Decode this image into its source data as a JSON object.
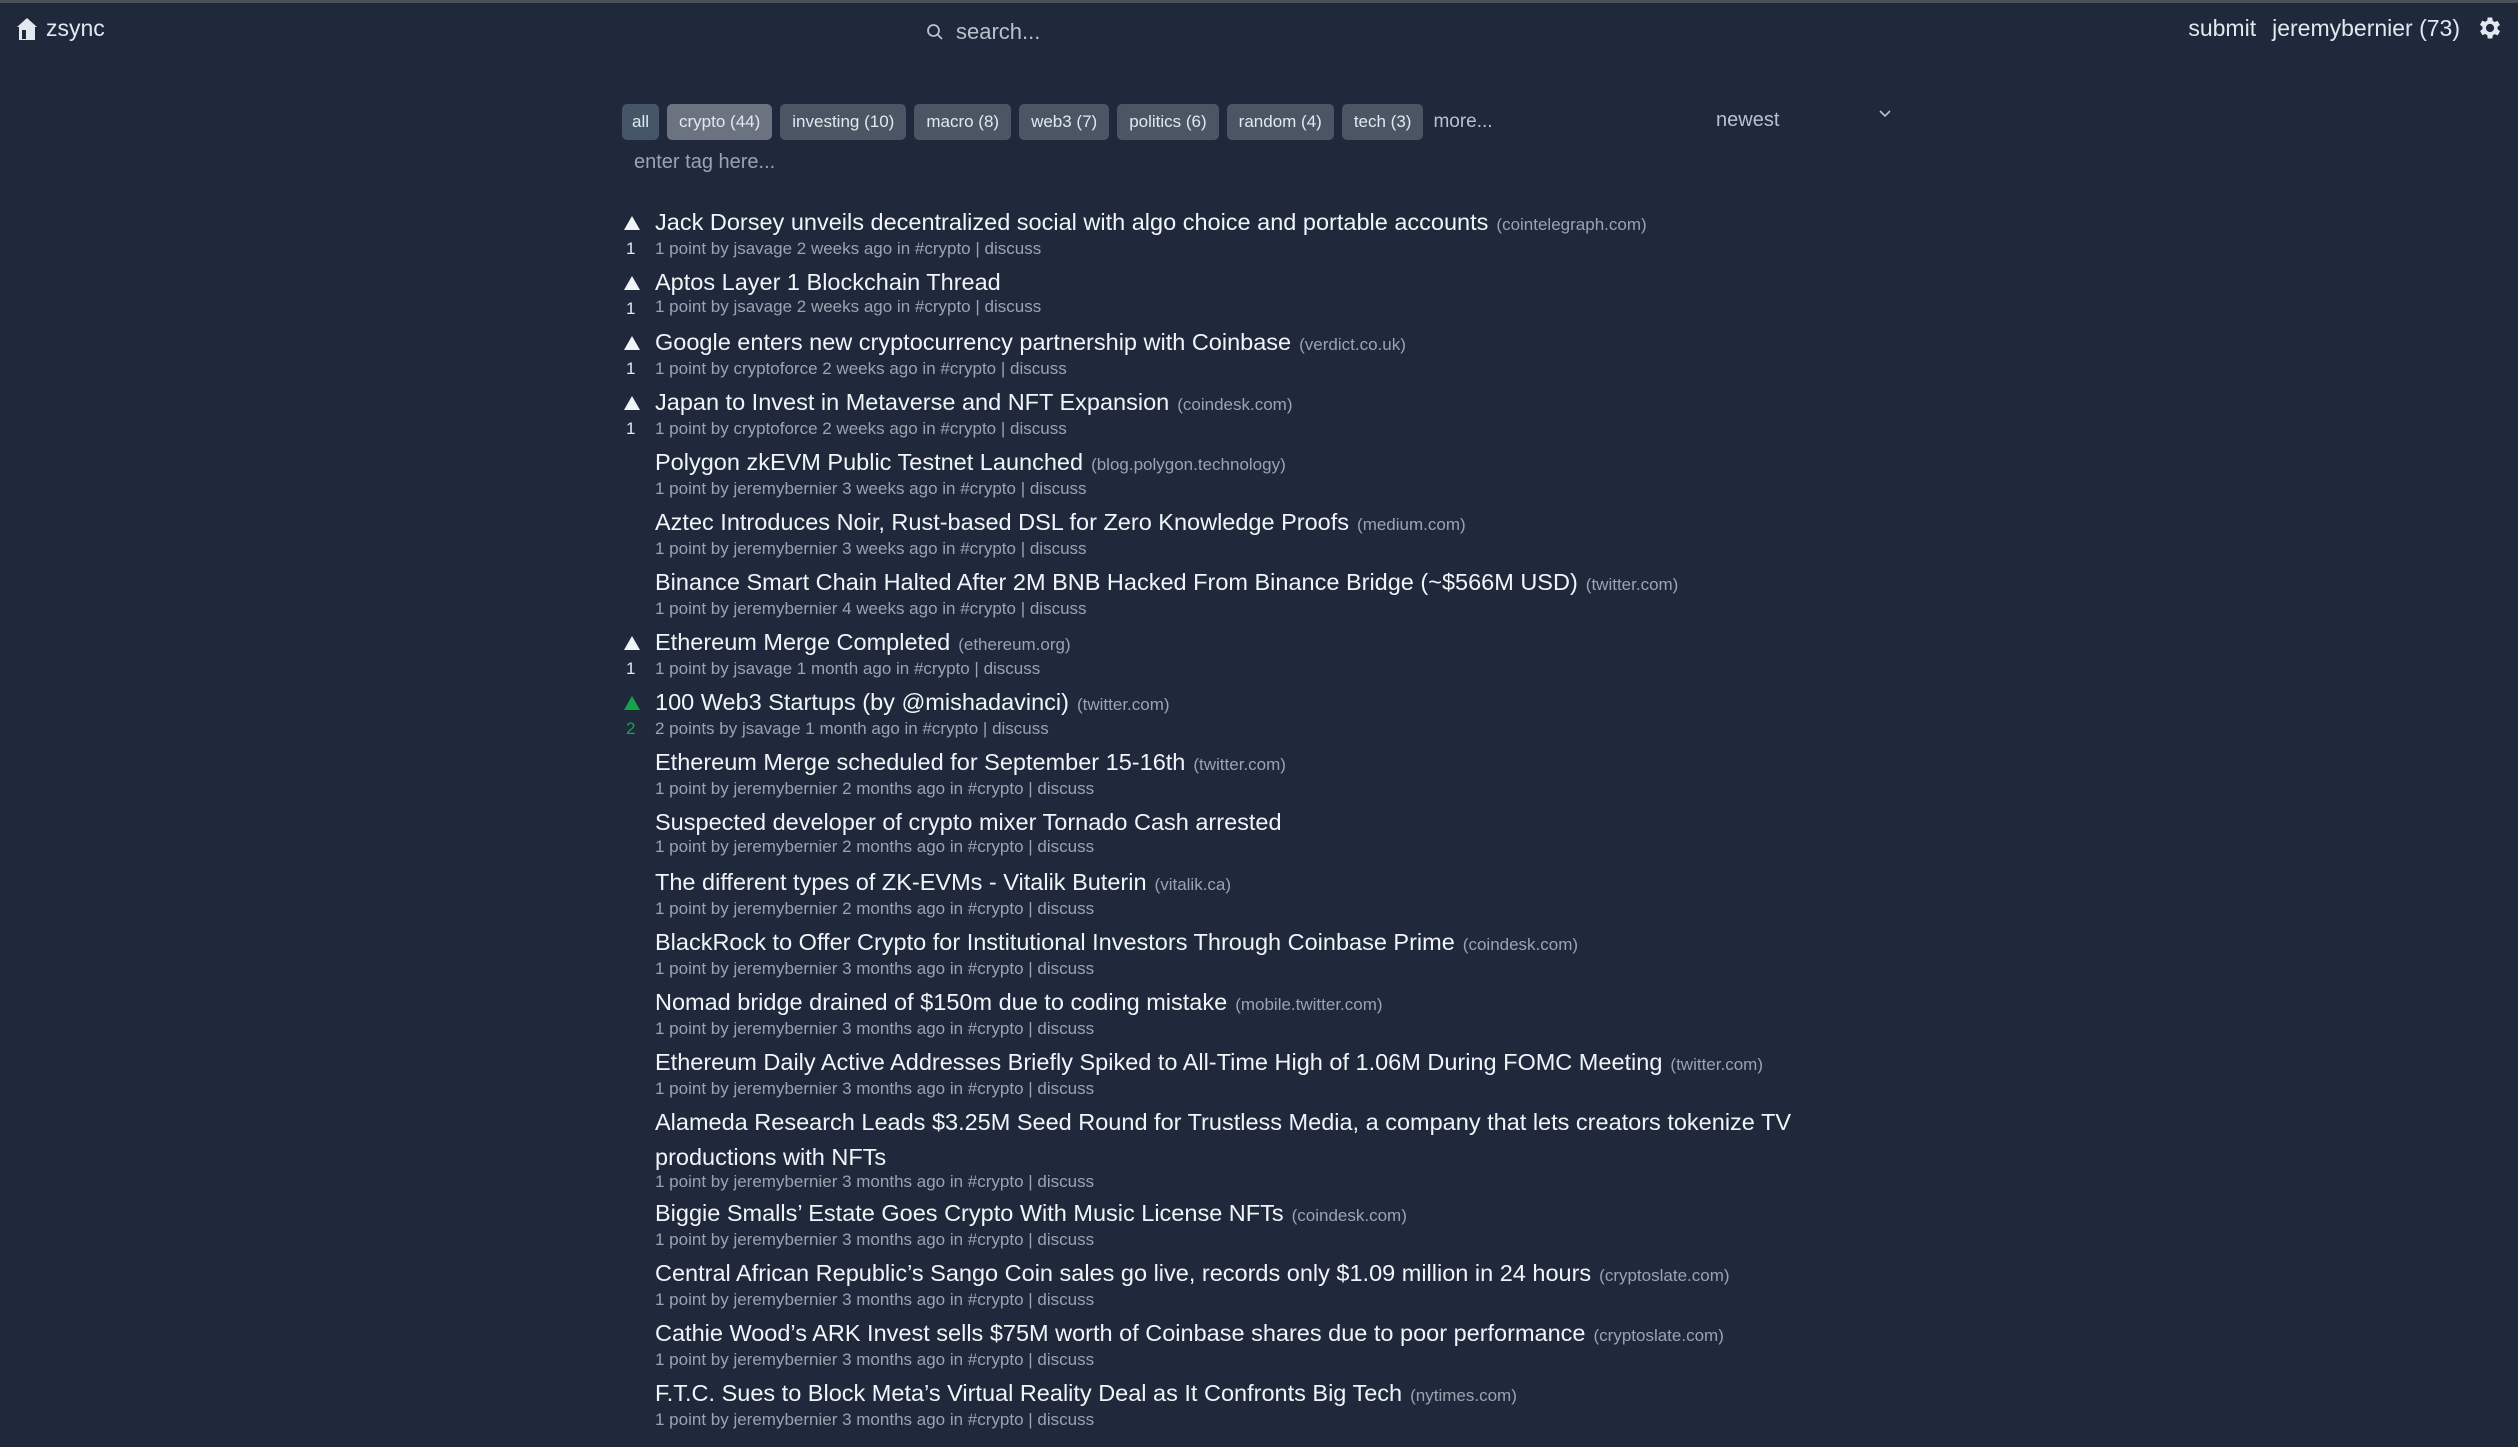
{
  "header": {
    "logo_icon": "home-icon",
    "app_name": "zsync",
    "search_placeholder": "search...",
    "theme_icon": "moon-icon",
    "submit_label": "submit",
    "user_label": "jeremybernier (73)",
    "settings_icon": "gear-icon"
  },
  "tags": {
    "items": [
      "all",
      "crypto (44)",
      "investing (10)",
      "macro (8)",
      "web3 (7)",
      "politics (6)",
      "random (4)",
      "tech (3)"
    ],
    "active": "crypto (44)",
    "more_label": "more...",
    "input_placeholder": "enter tag here..."
  },
  "sort": {
    "selected": "newest"
  },
  "colors": {
    "background": "#1f293b",
    "upvoted": "#16a34a",
    "tag": "#4b5563",
    "tag_active": "#6b7280"
  },
  "items": [
    {
      "title": "Jack Dorsey unveils decentralized social with algo choice and portable accounts",
      "domain": "(cointelegraph.com)",
      "meta": "1 point by jsavage 2 weeks ago in #crypto",
      "discuss": "discuss",
      "arrow": true,
      "score": "1",
      "upvoted": false
    },
    {
      "title": "Aptos Layer 1 Blockchain Thread",
      "domain": "",
      "meta": "1 point by jsavage 2 weeks ago in #crypto",
      "discuss": "discuss",
      "arrow": true,
      "score": "1",
      "upvoted": false
    },
    {
      "title": "Google enters new cryptocurrency partnership with Coinbase",
      "domain": "(verdict.co.uk)",
      "meta": "1 point by cryptoforce 2 weeks ago in #crypto",
      "discuss": "discuss",
      "arrow": true,
      "score": "1",
      "upvoted": false
    },
    {
      "title": "Japan to Invest in Metaverse and NFT Expansion",
      "domain": "(coindesk.com)",
      "meta": "1 point by cryptoforce 2 weeks ago in #crypto",
      "discuss": "discuss",
      "arrow": true,
      "score": "1",
      "upvoted": false
    },
    {
      "title": "Polygon zkEVM Public Testnet Launched",
      "domain": "(blog.polygon.technology)",
      "meta": "1 point by jeremybernier 3 weeks ago in #crypto",
      "discuss": "discuss",
      "arrow": false
    },
    {
      "title": "Aztec Introduces Noir, Rust-based DSL for Zero Knowledge Proofs",
      "domain": "(medium.com)",
      "meta": "1 point by jeremybernier 3 weeks ago in #crypto",
      "discuss": "discuss",
      "arrow": false
    },
    {
      "title": "Binance Smart Chain Halted After 2M BNB Hacked From Binance Bridge (~$566M USD)",
      "domain": "(twitter.com)",
      "meta": "1 point by jeremybernier 4 weeks ago in #crypto",
      "discuss": "discuss",
      "arrow": false
    },
    {
      "title": "Ethereum Merge Completed",
      "domain": "(ethereum.org)",
      "meta": "1 point by jsavage 1 month ago in #crypto",
      "discuss": "discuss",
      "arrow": true,
      "score": "1",
      "upvoted": false
    },
    {
      "title": "100 Web3 Startups (by @mishadavinci)",
      "domain": "(twitter.com)",
      "meta": "2 points by jsavage 1 month ago in #crypto",
      "discuss": "discuss",
      "arrow": true,
      "score": "2",
      "upvoted": true
    },
    {
      "title": "Ethereum Merge scheduled for September 15-16th",
      "domain": "(twitter.com)",
      "meta": "1 point by jeremybernier 2 months ago in #crypto",
      "discuss": "discuss",
      "arrow": false
    },
    {
      "title": "Suspected developer of crypto mixer Tornado Cash arrested",
      "domain": "",
      "meta": "1 point by jeremybernier 2 months ago in #crypto",
      "discuss": "discuss",
      "arrow": false
    },
    {
      "title": "The different types of ZK-EVMs - Vitalik Buterin",
      "domain": "(vitalik.ca)",
      "meta": "1 point by jeremybernier 2 months ago in #crypto",
      "discuss": "discuss",
      "arrow": false
    },
    {
      "title": "BlackRock to Offer Crypto for Institutional Investors Through Coinbase Prime",
      "domain": "(coindesk.com)",
      "meta": "1 point by jeremybernier 3 months ago in #crypto",
      "discuss": "discuss",
      "arrow": false
    },
    {
      "title": "Nomad bridge drained of $150m due to coding mistake",
      "domain": "(mobile.twitter.com)",
      "meta": "1 point by jeremybernier 3 months ago in #crypto",
      "discuss": "discuss",
      "arrow": false
    },
    {
      "title": "Ethereum Daily Active Addresses Briefly Spiked to All-Time High of 1.06M During FOMC Meeting",
      "domain": "(twitter.com)",
      "meta": "1 point by jeremybernier 3 months ago in #crypto",
      "discuss": "discuss",
      "arrow": false
    },
    {
      "title": "Alameda Research Leads $3.25M Seed Round for Trustless Media, a company that lets creators tokenize TV productions with NFTs",
      "domain": "",
      "meta": "1 point by jeremybernier 3 months ago in #crypto",
      "discuss": "discuss",
      "arrow": false
    },
    {
      "title": "Biggie Smalls’ Estate Goes Crypto With Music License NFTs",
      "domain": "(coindesk.com)",
      "meta": "1 point by jeremybernier 3 months ago in #crypto",
      "discuss": "discuss",
      "arrow": false
    },
    {
      "title": "Central African Republic’s Sango Coin sales go live, records only $1.09 million in 24 hours",
      "domain": "(cryptoslate.com)",
      "meta": "1 point by jeremybernier 3 months ago in #crypto",
      "discuss": "discuss",
      "arrow": false
    },
    {
      "title": "Cathie Wood’s ARK Invest sells $75M worth of Coinbase shares due to poor performance",
      "domain": "(cryptoslate.com)",
      "meta": "1 point by jeremybernier 3 months ago in #crypto",
      "discuss": "discuss",
      "arrow": false
    },
    {
      "title": "F.T.C. Sues to Block Meta’s Virtual Reality Deal as It Confronts Big Tech",
      "domain": "(nytimes.com)",
      "meta": "1 point by jeremybernier 3 months ago in #crypto",
      "discuss": "discuss",
      "arrow": false
    }
  ]
}
